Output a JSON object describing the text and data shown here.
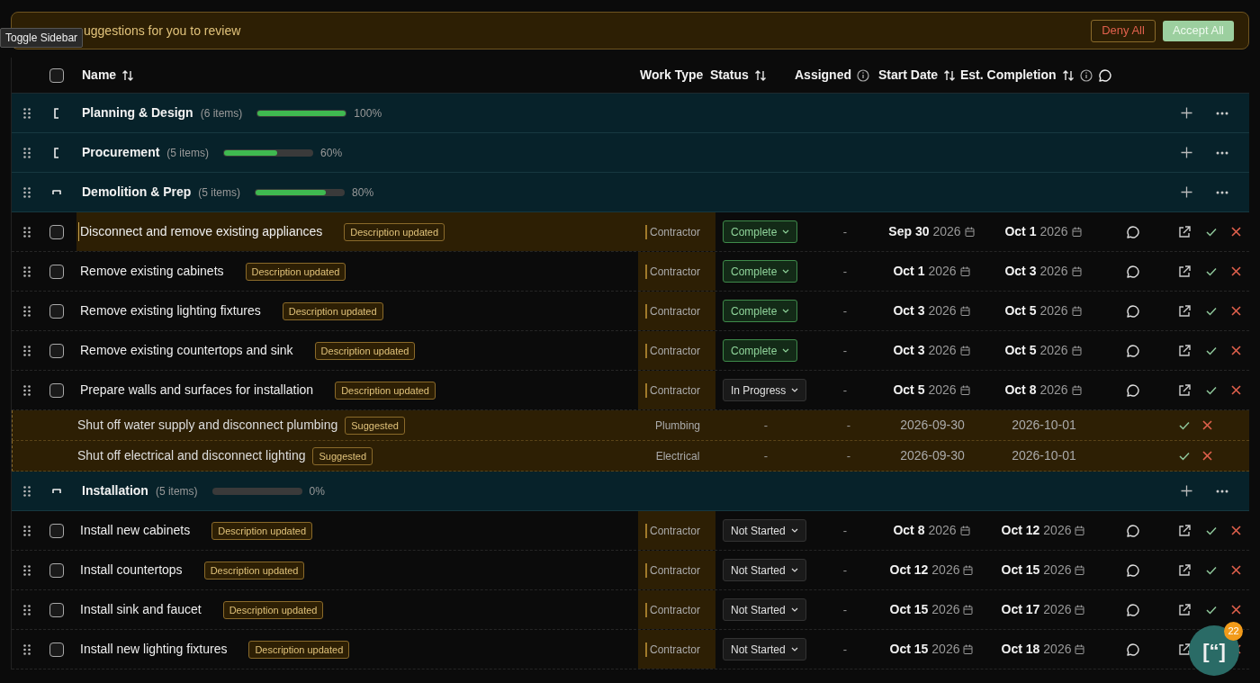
{
  "tooltip": "Toggle Sidebar",
  "banner": {
    "text": "uggestions for you to review",
    "deny": "Deny All",
    "accept": "Accept All"
  },
  "header": {
    "checked": false,
    "columns": [
      {
        "label": "Name",
        "sortable": true
      },
      {
        "label": "Work Type"
      },
      {
        "label": "Status",
        "sortable": true
      },
      {
        "label": "Assigned",
        "info": true
      },
      {
        "label": "Start Date",
        "sortable": true
      },
      {
        "label": "Est. Completion",
        "sortable": true,
        "info": true
      }
    ]
  },
  "groups": [
    {
      "name": "Planning & Design",
      "count": "(6 items)",
      "level": 1,
      "percent": "100%",
      "expanded": false
    },
    {
      "name": "Procurement",
      "count": "(5 items)",
      "level": 0.6,
      "percent": "60%",
      "expanded": false
    },
    {
      "name": "Demolition & Prep",
      "count": "(5 items)",
      "level": 0.8,
      "percent": "80%",
      "expanded": true,
      "tasks": [
        {
          "name": "Disconnect and remove existing appliances",
          "badge": "Description updated",
          "work_type": "Contractor",
          "status": "Complete",
          "complete": true,
          "assigned": "-",
          "start_day": "Sep 30",
          "start_year": "2026",
          "end_day": "Oct 1",
          "end_year": "2026",
          "checked": false,
          "highlighted": true
        },
        {
          "name": "Remove existing cabinets",
          "badge": "Description updated",
          "work_type": "Contractor",
          "status": "Complete",
          "complete": true,
          "assigned": "-",
          "start_day": "Oct 1",
          "start_year": "2026",
          "end_day": "Oct 3",
          "end_year": "2026",
          "checked": false,
          "highlighted": false
        },
        {
          "name": "Remove existing lighting fixtures",
          "badge": "Description updated",
          "work_type": "Contractor",
          "status": "Complete",
          "complete": true,
          "assigned": "-",
          "start_day": "Oct 3",
          "start_year": "2026",
          "end_day": "Oct 5",
          "end_year": "2026",
          "checked": false,
          "highlighted": false
        },
        {
          "name": "Remove existing countertops and sink",
          "badge": "Description updated",
          "work_type": "Contractor",
          "status": "Complete",
          "complete": true,
          "assigned": "-",
          "start_day": "Oct 3",
          "start_year": "2026",
          "end_day": "Oct 5",
          "end_year": "2026",
          "checked": false,
          "highlighted": false
        },
        {
          "name": "Prepare walls and surfaces for installation",
          "badge": "Description updated",
          "work_type": "Contractor",
          "status": "In Progress",
          "complete": false,
          "assigned": "-",
          "start_day": "Oct 5",
          "start_year": "2026",
          "end_day": "Oct 8",
          "end_year": "2026",
          "checked": false,
          "highlighted": false
        }
      ],
      "suggestions": [
        {
          "name": "Shut off water supply and disconnect plumbing",
          "badge": "Suggested",
          "work_type": "Plumbing",
          "status": "-",
          "assigned": "-",
          "start": "2026-09-30",
          "end": "2026-10-01"
        },
        {
          "name": "Shut off electrical and disconnect lighting",
          "badge": "Suggested",
          "work_type": "Electrical",
          "status": "-",
          "assigned": "-",
          "start": "2026-09-30",
          "end": "2026-10-01"
        }
      ]
    },
    {
      "name": "Installation",
      "count": "(5 items)",
      "level": 0,
      "percent": "0%",
      "expanded": true,
      "tasks": [
        {
          "name": "Install new cabinets",
          "badge": "Description updated",
          "work_type": "Contractor",
          "status": "Not Started",
          "complete": false,
          "assigned": "-",
          "start_day": "Oct 8",
          "start_year": "2026",
          "end_day": "Oct 12",
          "end_year": "2026",
          "checked": false,
          "highlighted": false
        },
        {
          "name": "Install countertops",
          "badge": "Description updated",
          "work_type": "Contractor",
          "status": "Not Started",
          "complete": false,
          "assigned": "-",
          "start_day": "Oct 12",
          "start_year": "2026",
          "end_day": "Oct 15",
          "end_year": "2026",
          "checked": false,
          "highlighted": false
        },
        {
          "name": "Install sink and faucet",
          "badge": "Description updated",
          "work_type": "Contractor",
          "status": "Not Started",
          "complete": false,
          "assigned": "-",
          "start_day": "Oct 15",
          "start_year": "2026",
          "end_day": "Oct 17",
          "end_year": "2026",
          "checked": false,
          "highlighted": false
        },
        {
          "name": "Install new lighting fixtures",
          "badge": "Description updated",
          "work_type": "Contractor",
          "status": "Not Started",
          "complete": false,
          "assigned": "-",
          "start_day": "Oct 15",
          "start_year": "2026",
          "end_day": "Oct 18",
          "end_year": "2026",
          "checked": false,
          "highlighted": false
        }
      ]
    }
  ],
  "fab": {
    "label": "[“]",
    "count": "22"
  }
}
